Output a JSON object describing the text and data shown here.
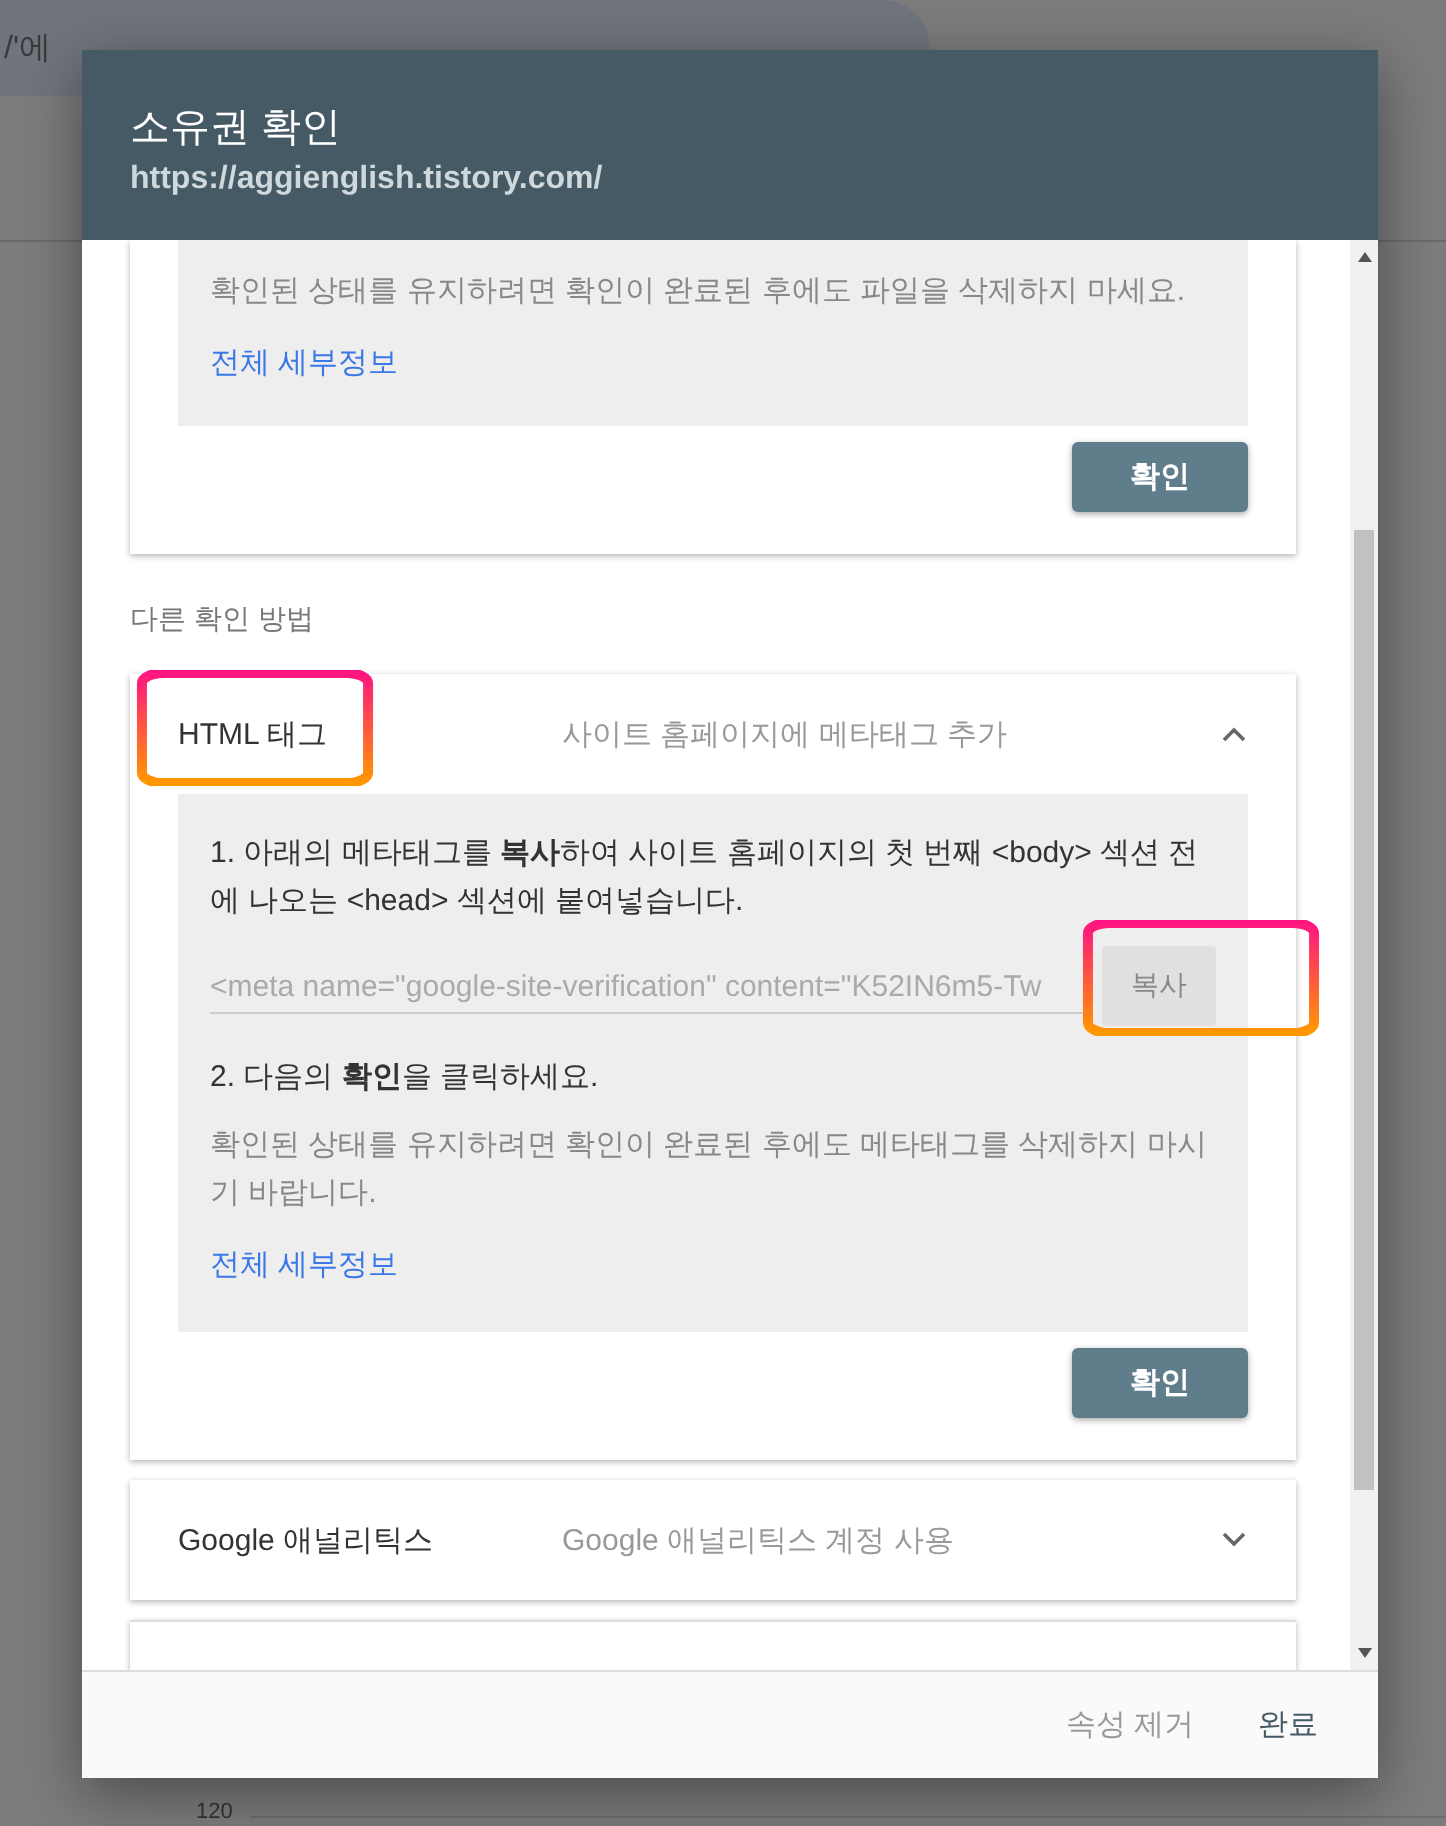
{
  "background": {
    "search_text": "/'에",
    "axis_label": "120"
  },
  "dialog": {
    "title": "소유권 확인",
    "subtitle": "https://aggienglish.tistory.com/",
    "top_card": {
      "note": "확인된 상태를 유지하려면 확인이 완료된 후에도 파일을 삭제하지 마세요.",
      "link": "전체 세부정보",
      "button": "확인"
    },
    "section_label": "다른 확인 방법",
    "methods": [
      {
        "name": "HTML 태그",
        "description": "사이트 홈페이지에 메타태그 추가",
        "expanded": true,
        "highlighted": true,
        "step1": "1. 아래의 메타태그를 **복사**하여 사이트 홈페이지의 첫 번째 <body> 섹션 전에 나오는 <head> 섹션에 붙여넣습니다.",
        "meta_tag": "<meta name=\"google-site-verification\" content=\"K52IN6m5-Tw",
        "copy_button": {
          "label": "복사",
          "highlighted": true
        },
        "step2": "2. 다음의 **확인**을 클릭하세요.",
        "note": "확인된 상태를 유지하려면 확인이 완료된 후에도 메타태그를 삭제하지 마시기 바랍니다.",
        "link": "전체 세부정보",
        "button": "확인"
      },
      {
        "name": "Google 애널리틱스",
        "description": "Google 애널리틱스 계정 사용",
        "expanded": false,
        "highlighted": false
      }
    ],
    "footer_buttons": [
      {
        "label": "속성 제거",
        "kind": "secondary"
      },
      {
        "label": "완료",
        "kind": "primary"
      }
    ]
  }
}
